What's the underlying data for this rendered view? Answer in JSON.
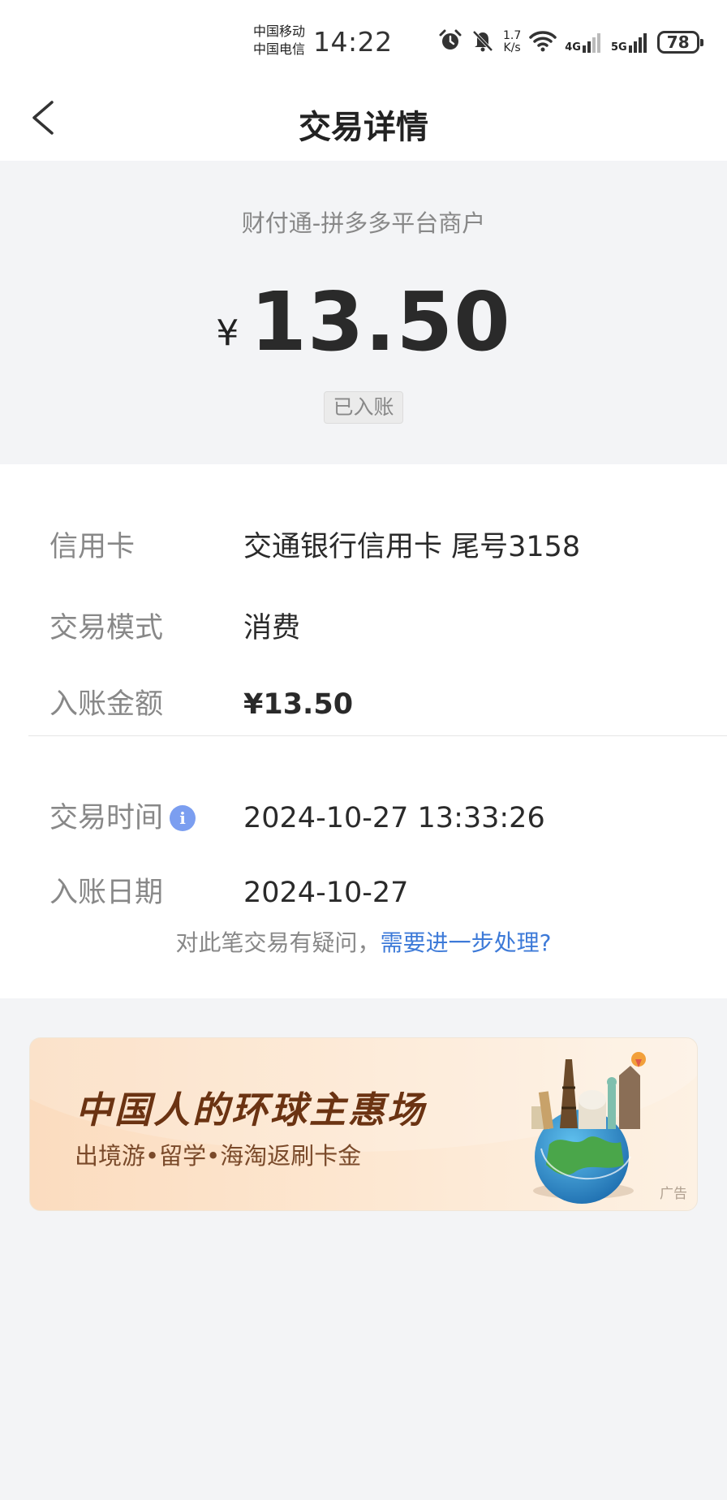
{
  "status_bar": {
    "carrier_1": "中国移动",
    "carrier_2": "中国电信",
    "time": "14:22",
    "net_speed_value": "1.7",
    "net_speed_unit": "K/s",
    "network_1": "4G",
    "network_2": "5G",
    "battery": "78",
    "icons": [
      "alarm-icon",
      "mute-icon",
      "wifi-icon",
      "signal-icon",
      "battery-icon"
    ]
  },
  "nav": {
    "title": "交易详情",
    "back_icon": "chevron-left-icon"
  },
  "summary": {
    "merchant": "财付通-拼多多平台商户",
    "currency_symbol": "¥",
    "amount": "13.50",
    "status": "已入账"
  },
  "details": [
    {
      "label": "信用卡",
      "value": "交通银行信用卡 尾号3158"
    },
    {
      "label": "交易模式",
      "value": "消费"
    },
    {
      "label": "入账金额",
      "value": "¥13.50"
    },
    {
      "label": "交易时间",
      "value": "2024-10-27 13:33:26",
      "icon": "info-icon"
    },
    {
      "label": "入账日期",
      "value": "2024-10-27"
    }
  ],
  "query": {
    "prompt": "对此笔交易有疑问，",
    "link": "需要进一步处理?"
  },
  "ad": {
    "title": "中国人的环球主惠场",
    "subtitle": "出境游•留学•海淘返刷卡金",
    "tag": "广告"
  },
  "colors": {
    "background": "#f3f4f6",
    "card": "#ffffff",
    "link": "#3d7ad8",
    "info": "#7b9ef0",
    "ad_title": "#6b3312"
  }
}
